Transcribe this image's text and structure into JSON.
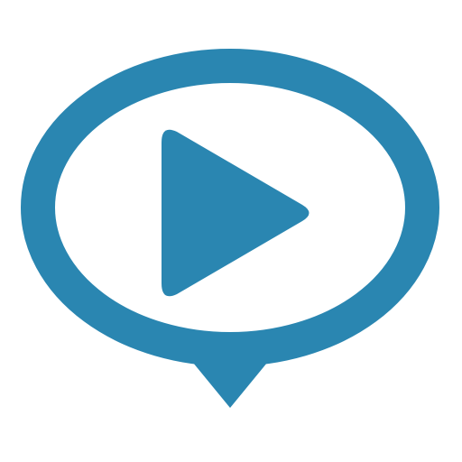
{
  "logo": {
    "icon": "speech-bubble-play-icon",
    "brand_color": "#2a86b1",
    "background_color": "#ffffff"
  }
}
